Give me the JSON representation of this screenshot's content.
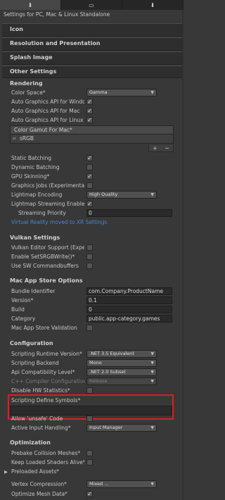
{
  "tabs": [
    {
      "icon": "download-icon",
      "glyph": "⬇"
    },
    {
      "icon": "window-icon",
      "glyph": "▭"
    },
    {
      "icon": "android-icon",
      "glyph": "⬇"
    }
  ],
  "subtitle": "Settings for PC, Mac & Linux Standalone",
  "foldouts": {
    "icon": "Icon",
    "resolution": "Resolution and Presentation",
    "splash": "Splash Image"
  },
  "other_settings": {
    "title": "Other Settings",
    "rendering": {
      "title": "Rendering",
      "color_space": {
        "label": "Color Space*",
        "value": "Gamma"
      },
      "auto_graphics_windows": {
        "label": "Auto Graphics API  for Windows",
        "checked": true
      },
      "auto_graphics_mac": {
        "label": "Auto Graphics API  for Mac",
        "checked": true
      },
      "auto_graphics_linux": {
        "label": "Auto Graphics API  for Linux",
        "checked": true
      },
      "color_gamut": {
        "header": "Color Gamut For Mac*",
        "items": [
          "sRGB"
        ],
        "add": "+",
        "remove": "−"
      },
      "static_batching": {
        "label": "Static Batching",
        "checked": true
      },
      "dynamic_batching": {
        "label": "Dynamic Batching",
        "checked": false
      },
      "gpu_skinning": {
        "label": "GPU Skinning*",
        "checked": true
      },
      "graphics_jobs": {
        "label": "Graphics Jobs (Experimental)",
        "checked": false
      },
      "lightmap_encoding": {
        "label": "Lightmap Encoding",
        "value": "High Quality"
      },
      "lightmap_streaming": {
        "label": "Lightmap Streaming Enabled",
        "checked": true
      },
      "streaming_priority": {
        "label": "Streaming Priority",
        "value": "0"
      },
      "vr_link": "Virtual Reality moved to XR Settings"
    },
    "vulkan": {
      "title": "Vulkan Settings",
      "editor_support": {
        "label": "Vulkan Editor Support (Experimental)",
        "checked": false
      },
      "srgb_write": {
        "label": "Enable SetSRGBWrite()*",
        "checked": false
      },
      "sw_commandbuffers": {
        "label": "Use SW Commandbuffers",
        "checked": false
      }
    },
    "mac_store": {
      "title": "Mac App Store Options",
      "bundle_identifier": {
        "label": "Bundle Identifier",
        "value": "com.Company.ProductName"
      },
      "version": {
        "label": "Version*",
        "value": "0.1"
      },
      "build": {
        "label": "Build",
        "value": "0"
      },
      "category": {
        "label": "Category",
        "value": "public.app-category.games"
      },
      "receipt_validation": {
        "label": "Mac App Store Validation",
        "checked": false
      }
    },
    "configuration": {
      "title": "Configuration",
      "runtime_version": {
        "label": "Scripting Runtime Version*",
        "value": ".NET 3.5 Equivalent"
      },
      "backend": {
        "label": "Scripting Backend",
        "value": "Mono"
      },
      "api_compat": {
        "label": "Api Compatibility Level*",
        "value": ".NET 2.0 Subset"
      },
      "cpp_compiler": {
        "label": "C++ Compiler Configuration",
        "value": "Release"
      },
      "disable_hw_stats": {
        "label": "Disable HW Statistics*",
        "checked": false
      },
      "define_symbols": {
        "label": "Scripting Define Symbols*",
        "value": ""
      },
      "allow_unsafe": {
        "label": "Allow 'unsafe' Code",
        "checked": false
      },
      "input_handling": {
        "label": "Active Input Handling*",
        "value": "Input Manager"
      }
    },
    "optimization": {
      "title": "Optimization",
      "prebake_collision": {
        "label": "Prebake Collision Meshes*",
        "checked": false
      },
      "keep_shaders": {
        "label": "Keep Loaded Shaders Alive*",
        "checked": false
      },
      "preloaded_assets": {
        "label": "Preloaded Assets*"
      },
      "vertex_compression": {
        "label": "Vertex Compression*",
        "value": "Mixed ..."
      },
      "optimize_mesh": {
        "label": "Optimize Mesh Data*",
        "checked": true
      }
    }
  },
  "colors": {
    "highlight": "#e11a28",
    "link": "#4c86c8"
  }
}
